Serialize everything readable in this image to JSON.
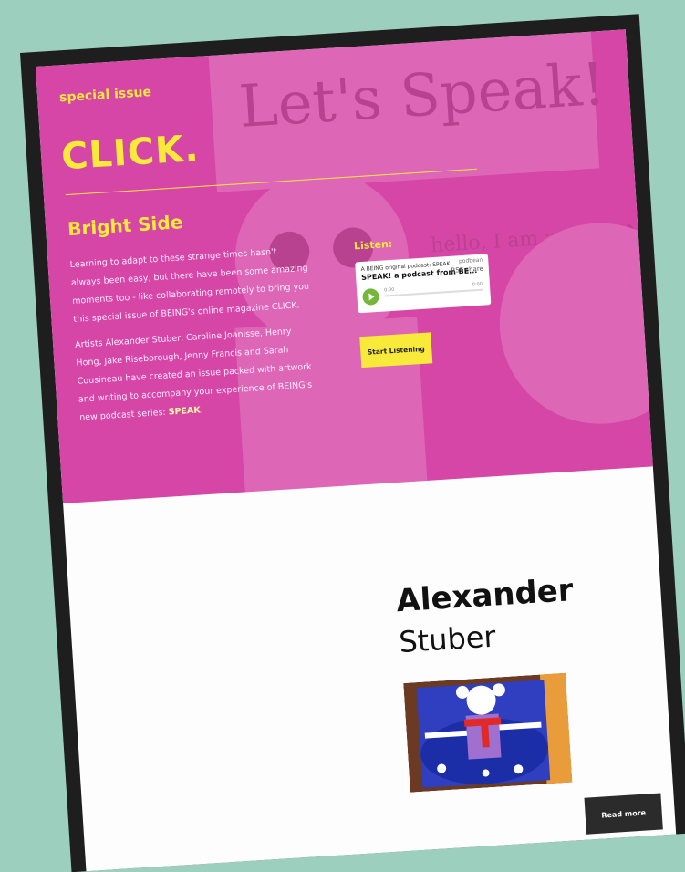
{
  "hero": {
    "kicker": "special issue",
    "title": "CLICK.",
    "heading": "Bright Side",
    "paragraph_1": "Learning to adapt to these strange times hasn't always been easy, but there have been some amazing moments too - like collaborating remotely to bring you this special issue of BEING's online magazine CLICK.",
    "paragraph_2": "Artists Alexander Stuber, Caroline Joanisse, Henry Hong, Jake Riseborough, Jenny Francis and Sarah Cousineau have created an issue packed with artwork and writing to accompany your experience of BEING's new podcast series:",
    "paragraph_2_strong": "SPEAK",
    "paragraph_2_end": ".",
    "background_art_text_1": "Let's Speak!",
    "background_art_text_2": "hello, I am an ALIEN!"
  },
  "listen": {
    "label": "Listen:",
    "player_subtitle": "A BEING original podcast: SPEAK!",
    "player_title": "SPEAK! a podcast from BE...",
    "player_logo": "podbean",
    "player_icons": "RSS  share",
    "time_left": "0:00",
    "time_right": "0:00",
    "start_button": "Start Listening"
  },
  "artist": {
    "first_name": "Alexander",
    "last_name": "Stuber",
    "read_more": "Read more"
  },
  "colors": {
    "hero_bg": "#d646a6",
    "accent_yellow": "#f7ea3b",
    "page_bg": "#9dcfbf",
    "frame": "#1e1e1e"
  }
}
